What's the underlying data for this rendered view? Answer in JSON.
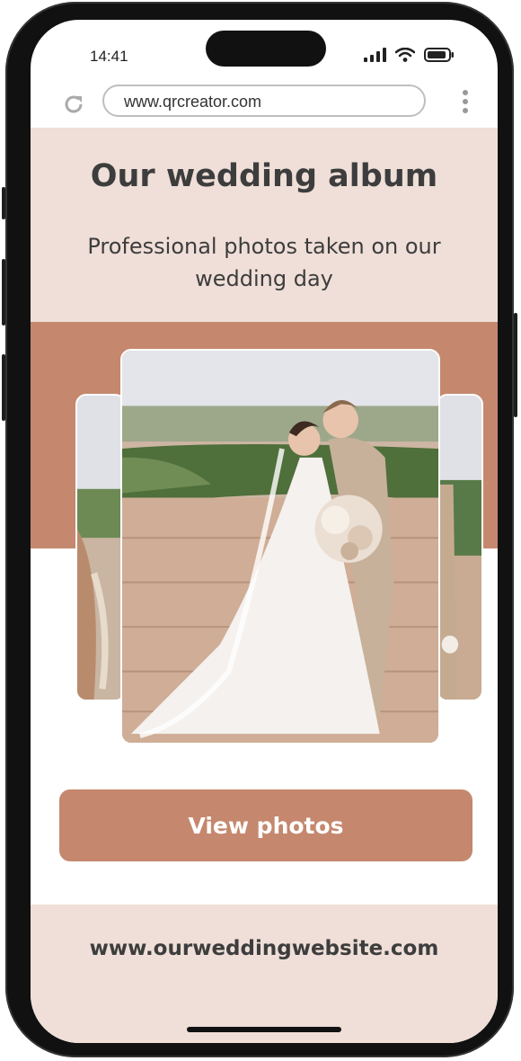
{
  "status_bar": {
    "time": "14:41"
  },
  "browser": {
    "url": "www.qrcreator.com"
  },
  "hero": {
    "title": "Our wedding album",
    "subtitle": "Professional photos taken on our wedding day"
  },
  "gallery": {
    "photos": [
      "wedding-photo-left",
      "wedding-photo-main",
      "wedding-photo-right"
    ]
  },
  "cta": {
    "label": "View photos"
  },
  "footer": {
    "website": "www.ourweddingwebsite.com"
  },
  "colors": {
    "accent": "#c5886e",
    "blush": "#efdfd8",
    "text": "#3d3d3d"
  },
  "icons": [
    "reload-icon",
    "signal-icon",
    "wifi-icon",
    "battery-icon",
    "more-vert-icon"
  ]
}
